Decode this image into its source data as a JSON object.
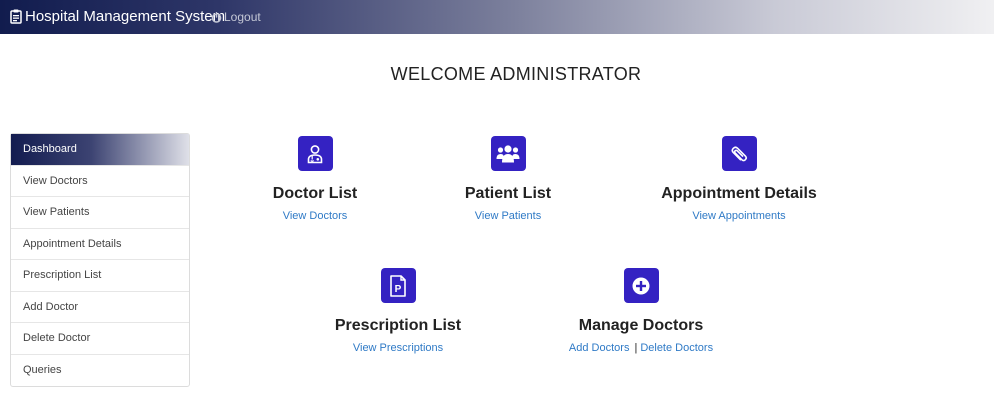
{
  "navbar": {
    "brand": "Hospital Management System",
    "brand_icon": "clipboard-icon",
    "logout_label": "Logout",
    "logout_icon": "power-icon"
  },
  "welcome": "WELCOME ADMINISTRATOR",
  "sidebar": {
    "items": [
      {
        "label": "Dashboard",
        "active": true
      },
      {
        "label": "View Doctors"
      },
      {
        "label": "View Patients"
      },
      {
        "label": "Appointment Details"
      },
      {
        "label": "Prescription List"
      },
      {
        "label": "Add Doctor"
      },
      {
        "label": "Delete Doctor"
      },
      {
        "label": "Queries"
      }
    ]
  },
  "cards": {
    "doctors": {
      "icon": "doctor-icon",
      "title": "Doctor List",
      "link": "View Doctors"
    },
    "patients": {
      "icon": "users-icon",
      "title": "Patient List",
      "link": "View Patients"
    },
    "appointments": {
      "icon": "paperclip-icon",
      "title": "Appointment Details",
      "link": "View Appointments"
    },
    "prescriptions": {
      "icon": "prescription-file-icon",
      "title": "Prescription List",
      "link": "View Prescriptions"
    },
    "manage": {
      "icon": "plus-circle-icon",
      "title": "Manage Doctors",
      "link_add": "Add Doctors",
      "separator": "|",
      "link_delete": "Delete Doctors"
    }
  },
  "colors": {
    "accent": "#3422c2",
    "link": "#2f7ac6",
    "navbar_dark": "#111c4e"
  }
}
